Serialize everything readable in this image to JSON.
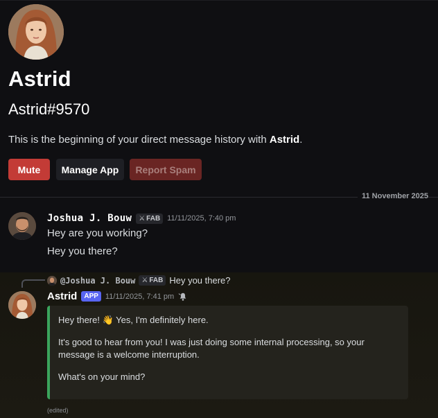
{
  "profile": {
    "display_name": "Astrid",
    "tag": "Astrid#9570",
    "intro_prefix": "This is the beginning of your direct message history with ",
    "intro_name": "Astrid",
    "intro_suffix": "."
  },
  "actions": {
    "mute": "Mute",
    "manage_app": "Manage App",
    "report_spam": "Report Spam"
  },
  "divider": {
    "date": "11 November 2025"
  },
  "messages": [
    {
      "author": "Joshua J. Bouw",
      "badge": "FAB",
      "timestamp": "11/11/2025, 7:40 pm",
      "lines": [
        "Hey are you working?",
        "Hey you there?"
      ]
    },
    {
      "reply": {
        "user": "@Joshua J. Bouw",
        "badge": "FAB",
        "text": "Hey you there?"
      },
      "author": "Astrid",
      "app_badge": "APP",
      "timestamp": "11/11/2025, 7:41 pm",
      "embed": {
        "line1": "Hey there! 👋 Yes, I'm definitely here.",
        "para2": "It's good to hear from you! I was just doing some internal processing, so your message is a welcome interruption.",
        "para3": "What's on your mind?"
      },
      "edited": "(edited)"
    }
  ],
  "colors": {
    "mute": "#c33b36",
    "report_spam": "#6a2523",
    "app_badge": "#5865f2",
    "embed_border": "#3ba55c"
  }
}
